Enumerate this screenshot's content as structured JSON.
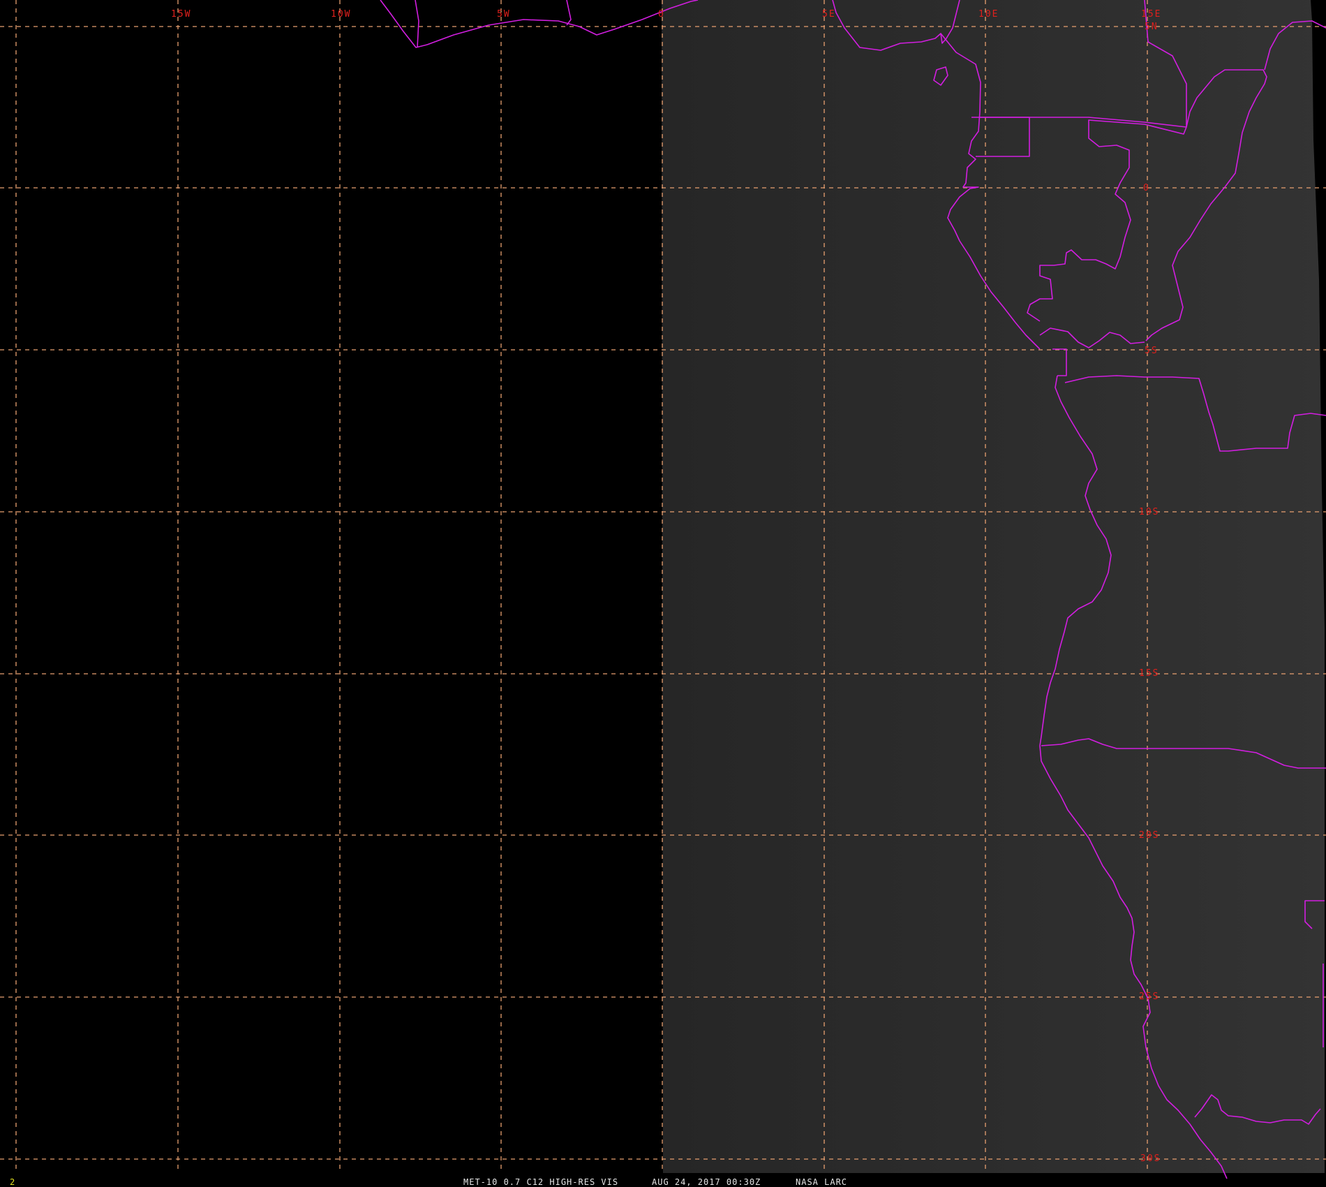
{
  "map": {
    "longitude_labels": [
      "15W",
      "10W",
      "5W",
      "0",
      "5E",
      "10E",
      "15E"
    ],
    "latitude_labels": [
      "5N",
      "0",
      "5S",
      "10S",
      "15S",
      "20S",
      "25S",
      "30S"
    ],
    "image_region": "daylit satellite imagery east of ~0° longitude; night (black) to the west",
    "colors": {
      "grid": "#e8a070",
      "borders": "#d21ee0",
      "grid_labels": "#e0201c",
      "day_side": "#2e2e2e",
      "night_side": "#000000",
      "frame_number": "#e0e020",
      "status_text": "#e6e6e6"
    }
  },
  "status_bar": {
    "frame_number": "2",
    "product": "MET-10 0.7 C12 HIGH-RES VIS",
    "datetime": "AUG 24, 2017 00:30Z",
    "source": "NASA LARC"
  }
}
